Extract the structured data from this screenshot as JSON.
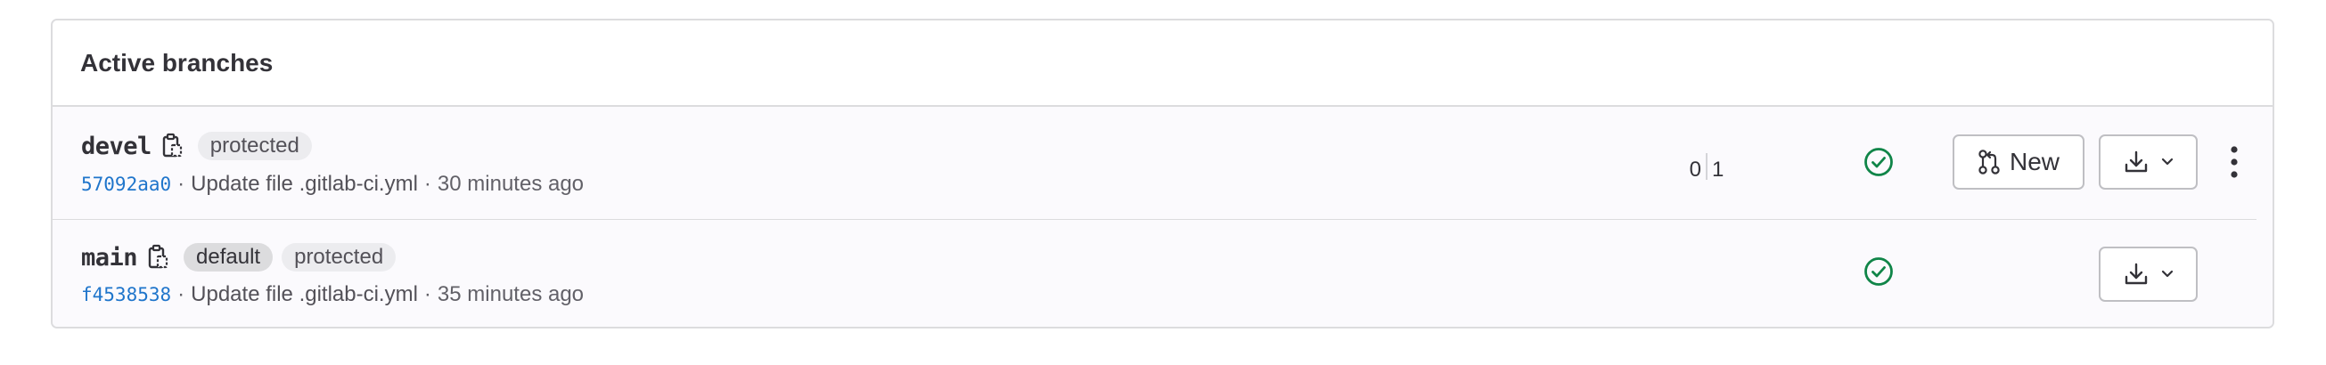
{
  "section": {
    "title": "Active branches"
  },
  "branches": [
    {
      "name": "devel",
      "badges": [
        "protected"
      ],
      "commit_sha": "57092aa0",
      "commit_message": "Update file .gitlab-ci.yml",
      "separator": "·",
      "time_ago": "30 minutes ago",
      "behind": "0",
      "ahead": "1",
      "pipeline_status": "passed",
      "new_mr_label": "New"
    },
    {
      "name": "main",
      "badges": [
        "default",
        "protected"
      ],
      "commit_sha": "f4538538",
      "commit_message": "Update file .gitlab-ci.yml",
      "separator": "·",
      "time_ago": "35 minutes ago",
      "pipeline_status": "passed"
    }
  ],
  "icons": {
    "copy": "copy-to-clipboard-icon",
    "pipeline": "status-success-icon",
    "merge_request": "merge-request-icon",
    "download": "download-icon",
    "chevron": "chevron-down-icon",
    "more": "ellipsis-v-icon"
  },
  "colors": {
    "success": "#108548",
    "link": "#1f75cb",
    "badge_bg": "#ececef",
    "border": "#dcdcde"
  }
}
